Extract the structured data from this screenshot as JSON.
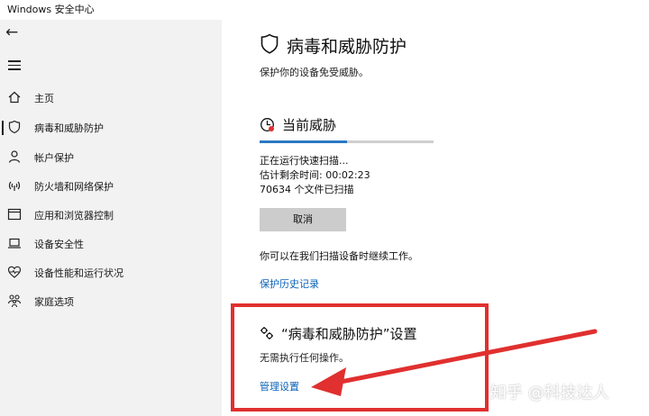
{
  "window": {
    "title": "Windows 安全中心"
  },
  "sidebar": {
    "back_icon": "back-arrow-icon",
    "menu_icon": "hamburger-menu-icon",
    "items": [
      {
        "label": "主页",
        "icon": "home-icon",
        "active": false
      },
      {
        "label": "病毒和威胁防护",
        "icon": "shield-icon",
        "active": true
      },
      {
        "label": "帐户保护",
        "icon": "person-icon",
        "active": false
      },
      {
        "label": "防火墙和网络保护",
        "icon": "wifi-signal-icon",
        "active": false
      },
      {
        "label": "应用和浏览器控制",
        "icon": "app-window-icon",
        "active": false
      },
      {
        "label": "设备安全性",
        "icon": "laptop-icon",
        "active": false
      },
      {
        "label": "设备性能和运行状况",
        "icon": "heart-icon",
        "active": false
      },
      {
        "label": "家庭选项",
        "icon": "family-icon",
        "active": false
      }
    ]
  },
  "main": {
    "title": "病毒和威胁防护",
    "subtitle": "保护你的设备免受威胁。",
    "current_threats": {
      "title": "当前威胁",
      "progress_fraction": 0.5,
      "status_lines": [
        "正在运行快速扫描...",
        "估计剩余时间: 00:02:23",
        "70634 个文件已扫描"
      ],
      "cancel_label": "取消",
      "note": "你可以在我们扫描设备时继续工作。",
      "history_link": "保护历史记录"
    },
    "settings": {
      "title": "“病毒和威胁防护”设置",
      "description": "无需执行任何操作。",
      "manage_link": "管理设置"
    }
  },
  "annotation": {
    "color": "#e0302f"
  },
  "watermark": {
    "text": "知乎 @科技达人"
  },
  "colors": {
    "accent": "#2b79c2",
    "link": "#0b63b8",
    "sidebar_bg": "#f2f2f2"
  }
}
